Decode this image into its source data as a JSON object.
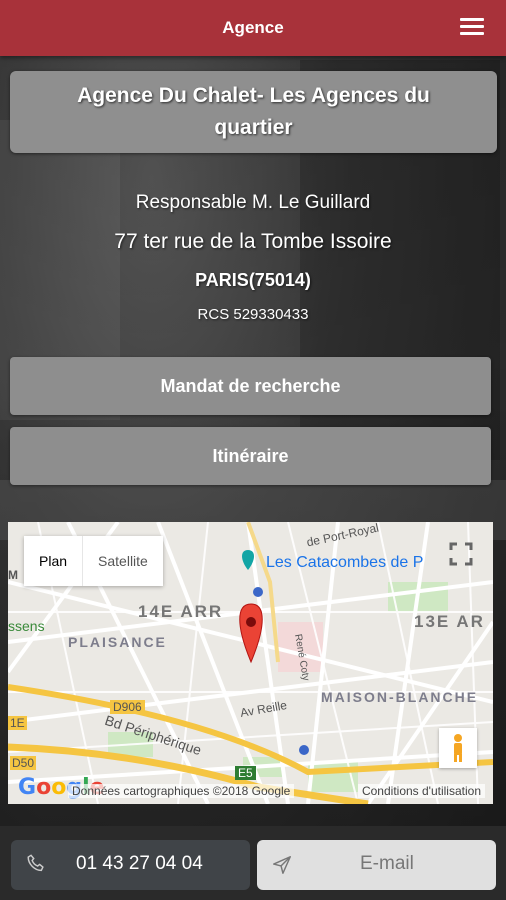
{
  "header": {
    "title": "Agence",
    "menu_icon": "hamburger-menu-icon",
    "color": "#a8323a"
  },
  "agency": {
    "name": "Agence Du Chalet- Les Agences du quartier",
    "manager": "Responsable M. Le Guillard",
    "address": "77 ter rue de la Tombe Issoire",
    "city": "PARIS(75014)",
    "rcs": "RCS 529330433"
  },
  "actions": {
    "mandat_label": "Mandat de recherche",
    "itineraire_label": "Itinéraire"
  },
  "map": {
    "tabs": [
      "Plan",
      "Satellite"
    ],
    "active_tab": "Plan",
    "labels": {
      "district_14": "14E ARR",
      "district_13": "13E AR",
      "plaisance": "PLAISANCE",
      "maison_blanche": "MAISON-BLANCHE",
      "catacombes": "Les Catacombes de P",
      "road_d906": "D906",
      "road_d50": "D50",
      "road_e5": "E5",
      "road_1e": "1E",
      "bd_peripherique": "Bd Périphérique",
      "av_reille": "Av Reille",
      "sens": "ssens",
      "port_royal": "de Port-Royal",
      "mon": "Mon",
      "m": "M",
      "rue_coty": "René Coty"
    },
    "attribution": "Données cartographiques ©2018 Google",
    "terms": "Conditions d'utilisation",
    "logo": "Google"
  },
  "contact": {
    "phone": "01 43 27 04 04",
    "email_label": "E-mail"
  }
}
